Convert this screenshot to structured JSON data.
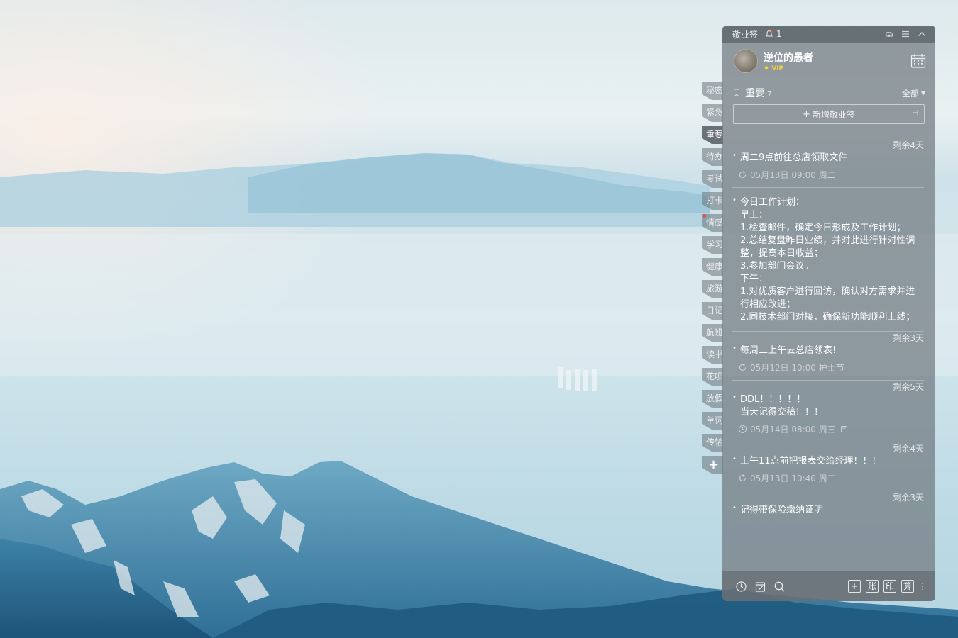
{
  "app": {
    "title": "敬业签",
    "notification_count": "1"
  },
  "user": {
    "name": "逆位的愚者",
    "badge": "VIP"
  },
  "side_tabs": [
    {
      "label": "秘密"
    },
    {
      "label": "紧急"
    },
    {
      "label": "重要",
      "active": true
    },
    {
      "label": "待办"
    },
    {
      "label": "考试"
    },
    {
      "label": "打卡"
    },
    {
      "label": "情感",
      "dot": true
    },
    {
      "label": "学习"
    },
    {
      "label": "健康"
    },
    {
      "label": "旅游"
    },
    {
      "label": "日记"
    },
    {
      "label": "航班"
    },
    {
      "label": "读书"
    },
    {
      "label": "花呗"
    },
    {
      "label": "放假"
    },
    {
      "label": "单词"
    },
    {
      "label": "传输"
    }
  ],
  "side_add_label": "+",
  "section": {
    "title": "重要",
    "count": "7",
    "filter": "全部",
    "add_placeholder": "新增敬业签"
  },
  "notes": [
    {
      "remain": "剩余4天",
      "content": "周二9点前往总店领取文件",
      "meta": "05月13日 09:00 周二",
      "icon": "repeat"
    },
    {
      "remain": "",
      "content": "今日工作计划：\n早上：\n1.检查邮件，确定今日形成及工作计划；\n2.总结复盘昨日业绩，并对此进行针对性调整，提高本日收益；\n3.参加部门会议。\n下午：\n1.对优质客户进行回访，确认对方需求并进行相应改进；\n2.同技术部门对接，确保新功能顺利上线；",
      "meta": "",
      "icon": ""
    },
    {
      "remain": "剩余3天",
      "content": "每周二上午去总店领表!",
      "meta": "05月12日 10:00 护士节",
      "icon": "repeat"
    },
    {
      "remain": "剩余5天",
      "content": "DDL！！！！！\n当天记得交稿！！！",
      "meta": "05月14日 08:00 周三",
      "icon": "clock"
    },
    {
      "remain": "剩余4天",
      "content": "上午11点前把报表交给经理！！！",
      "meta": "05月13日 10:40 周二",
      "icon": "repeat"
    },
    {
      "remain": "剩余3天",
      "content": "记得带保险缴纳证明",
      "meta": "",
      "icon": ""
    }
  ],
  "bottom": {
    "boxes": [
      "+",
      "账",
      "印",
      "算"
    ]
  },
  "colors": {
    "panel": "#70787F",
    "vip": "#F5D33A",
    "dot": "#E74C3C"
  }
}
